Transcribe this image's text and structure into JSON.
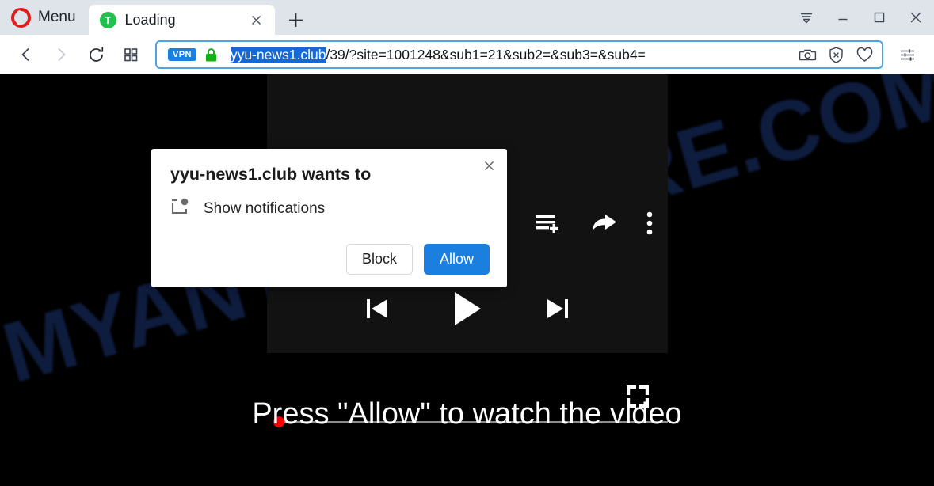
{
  "browser": {
    "menu_label": "Menu",
    "tab": {
      "favicon_letter": "T",
      "favicon_icon": "green-circle-t-favicon",
      "title": "Loading",
      "close_icon": "close-icon"
    },
    "new_tab_icon": "plus-icon",
    "window_controls": {
      "tab_list_icon": "tab-list-dropdown-icon",
      "minimize_icon": "minimize-icon",
      "maximize_icon": "maximize-icon",
      "close_icon": "close-icon"
    },
    "nav": {
      "back_icon": "back-arrow-icon",
      "forward_icon": "forward-arrow-icon",
      "reload_icon": "reload-icon",
      "speeddial_icon": "speed-dial-grid-icon"
    },
    "address_bar": {
      "vpn_badge": "VPN",
      "lock_icon": "padlock-icon",
      "url_host": "yyu-news1.club",
      "url_path": "/39/?site=1001248&sub1=21&sub2=&sub3=&sub4=",
      "full_url": "yyu-news1.club/39/?site=1001248&sub1=21&sub2=&sub3=&sub4=",
      "snapshot_icon": "camera-icon",
      "adblock_icon": "shield-block-icon",
      "favorite_icon": "heart-icon"
    },
    "easy_setup_icon": "sliders-icon"
  },
  "permission_dialog": {
    "title": "yyu-news1.club wants to",
    "permission_label": "Show notifications",
    "permission_icon": "notification-icon",
    "close_icon": "close-icon",
    "block_label": "Block",
    "allow_label": "Allow"
  },
  "page": {
    "watermark": "MYANTISPYWARE.COM",
    "cta_text": "Press \"Allow\" to watch the video",
    "player": {
      "queue_icon": "playlist-add-icon",
      "share_icon": "share-arrow-icon",
      "more_icon": "more-vertical-icon",
      "previous_icon": "previous-track-icon",
      "play_icon": "play-icon",
      "next_icon": "next-track-icon",
      "fullscreen_icon": "fullscreen-icon",
      "progress_percent": 0
    }
  },
  "colors": {
    "accent_blue": "#1b7fe0",
    "url_highlight": "#1668d4",
    "opera_red": "#e21b1b",
    "favicon_green": "#22c14e",
    "progress_red": "#f80000",
    "watermark_navy": "#0e1c3e"
  }
}
